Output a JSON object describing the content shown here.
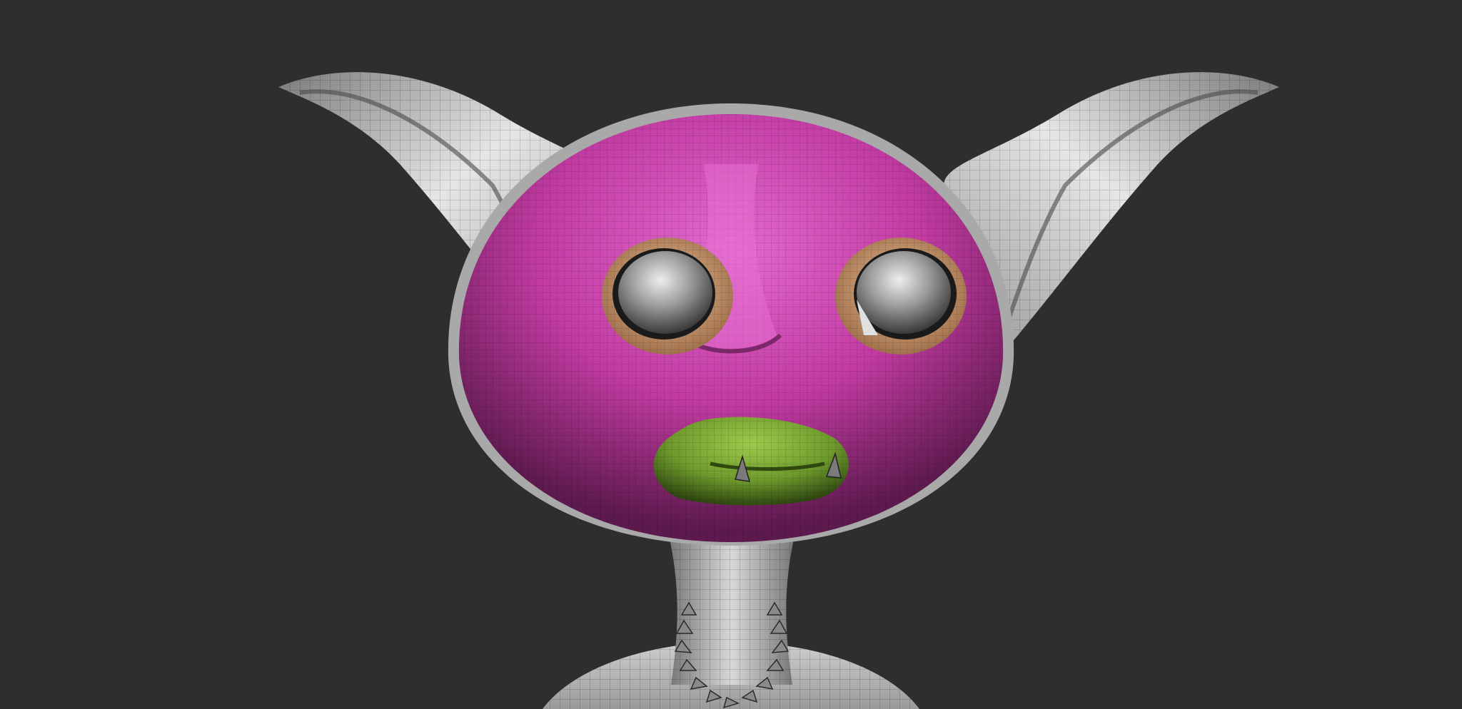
{
  "viewport": {
    "background_color": "#2e2e2e"
  },
  "model": {
    "subject": "goblin-creature-head-bust",
    "render_style": "wireframe-polygroups",
    "colors": {
      "skin_gray": "#bdbdbd",
      "face_polygroup": "#c83ea8",
      "eye_socket_polygroup": "#d8a27a",
      "lips_polygroup": "#6e9a2c",
      "eyeball": "#9a9a9a",
      "necklace": "#8a8a8a",
      "wire": "#000000"
    }
  }
}
